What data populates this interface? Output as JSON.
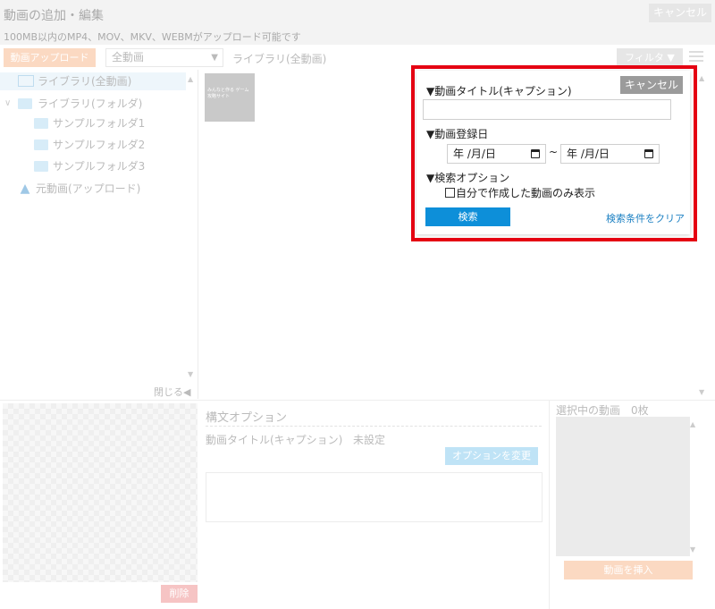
{
  "header": {
    "title": "動画の追加・編集",
    "subtitle": "100MB以内のMP4、MOV、MKV、WEBMがアップロード可能です",
    "cancel_label": "キャンセル"
  },
  "toolbar": {
    "upload_label": "動画アップロード",
    "filter_select_value": "全動画",
    "current_path": "ライブラリ(全動画)",
    "filter_label": "フィルタ ▼"
  },
  "sidebar": {
    "items": [
      {
        "label": "ライブラリ(全動画)",
        "icon": "image-icon",
        "selected": true
      },
      {
        "label": "ライブラリ(フォルダ)",
        "icon": "folder-icon",
        "expanded": true
      },
      {
        "label": "サンプルフォルダ1",
        "icon": "folder-icon"
      },
      {
        "label": "サンプルフォルダ2",
        "icon": "folder-icon"
      },
      {
        "label": "サンプルフォルダ3",
        "icon": "folder-icon"
      },
      {
        "label": "元動画(アップロード)",
        "icon": "upload-icon"
      }
    ],
    "close_label": "閉じる◀"
  },
  "library": {
    "thumbnail_text": "みんなと作る ゲーム攻略サイト"
  },
  "filter_panel": {
    "title_label": "▼動画タイトル(キャプション)",
    "title_input_value": "",
    "cancel_label": "キャンセル",
    "date_label": "▼動画登録日",
    "date_from_placeholder": "年 /月/日",
    "date_to_placeholder": "年 /月/日",
    "date_separator": "~",
    "search_options_label": "▼検索オプション",
    "only_mine_label": "自分で作成した動画のみ表示",
    "only_mine_checked": false,
    "search_button_label": "検索",
    "clear_link_label": "検索条件をクリア",
    "highlight_color": "#e50012",
    "search_button_color": "#0d8fd9"
  },
  "bottom": {
    "delete_label": "削除",
    "options_title": "構文オプション",
    "caption_label": "動画タイトル(キャプション)",
    "caption_value": "未設定",
    "change_option_label": "オプションを変更",
    "selected_videos_title": "選択中の動画　0枚",
    "insert_label": "動画を挿入"
  }
}
